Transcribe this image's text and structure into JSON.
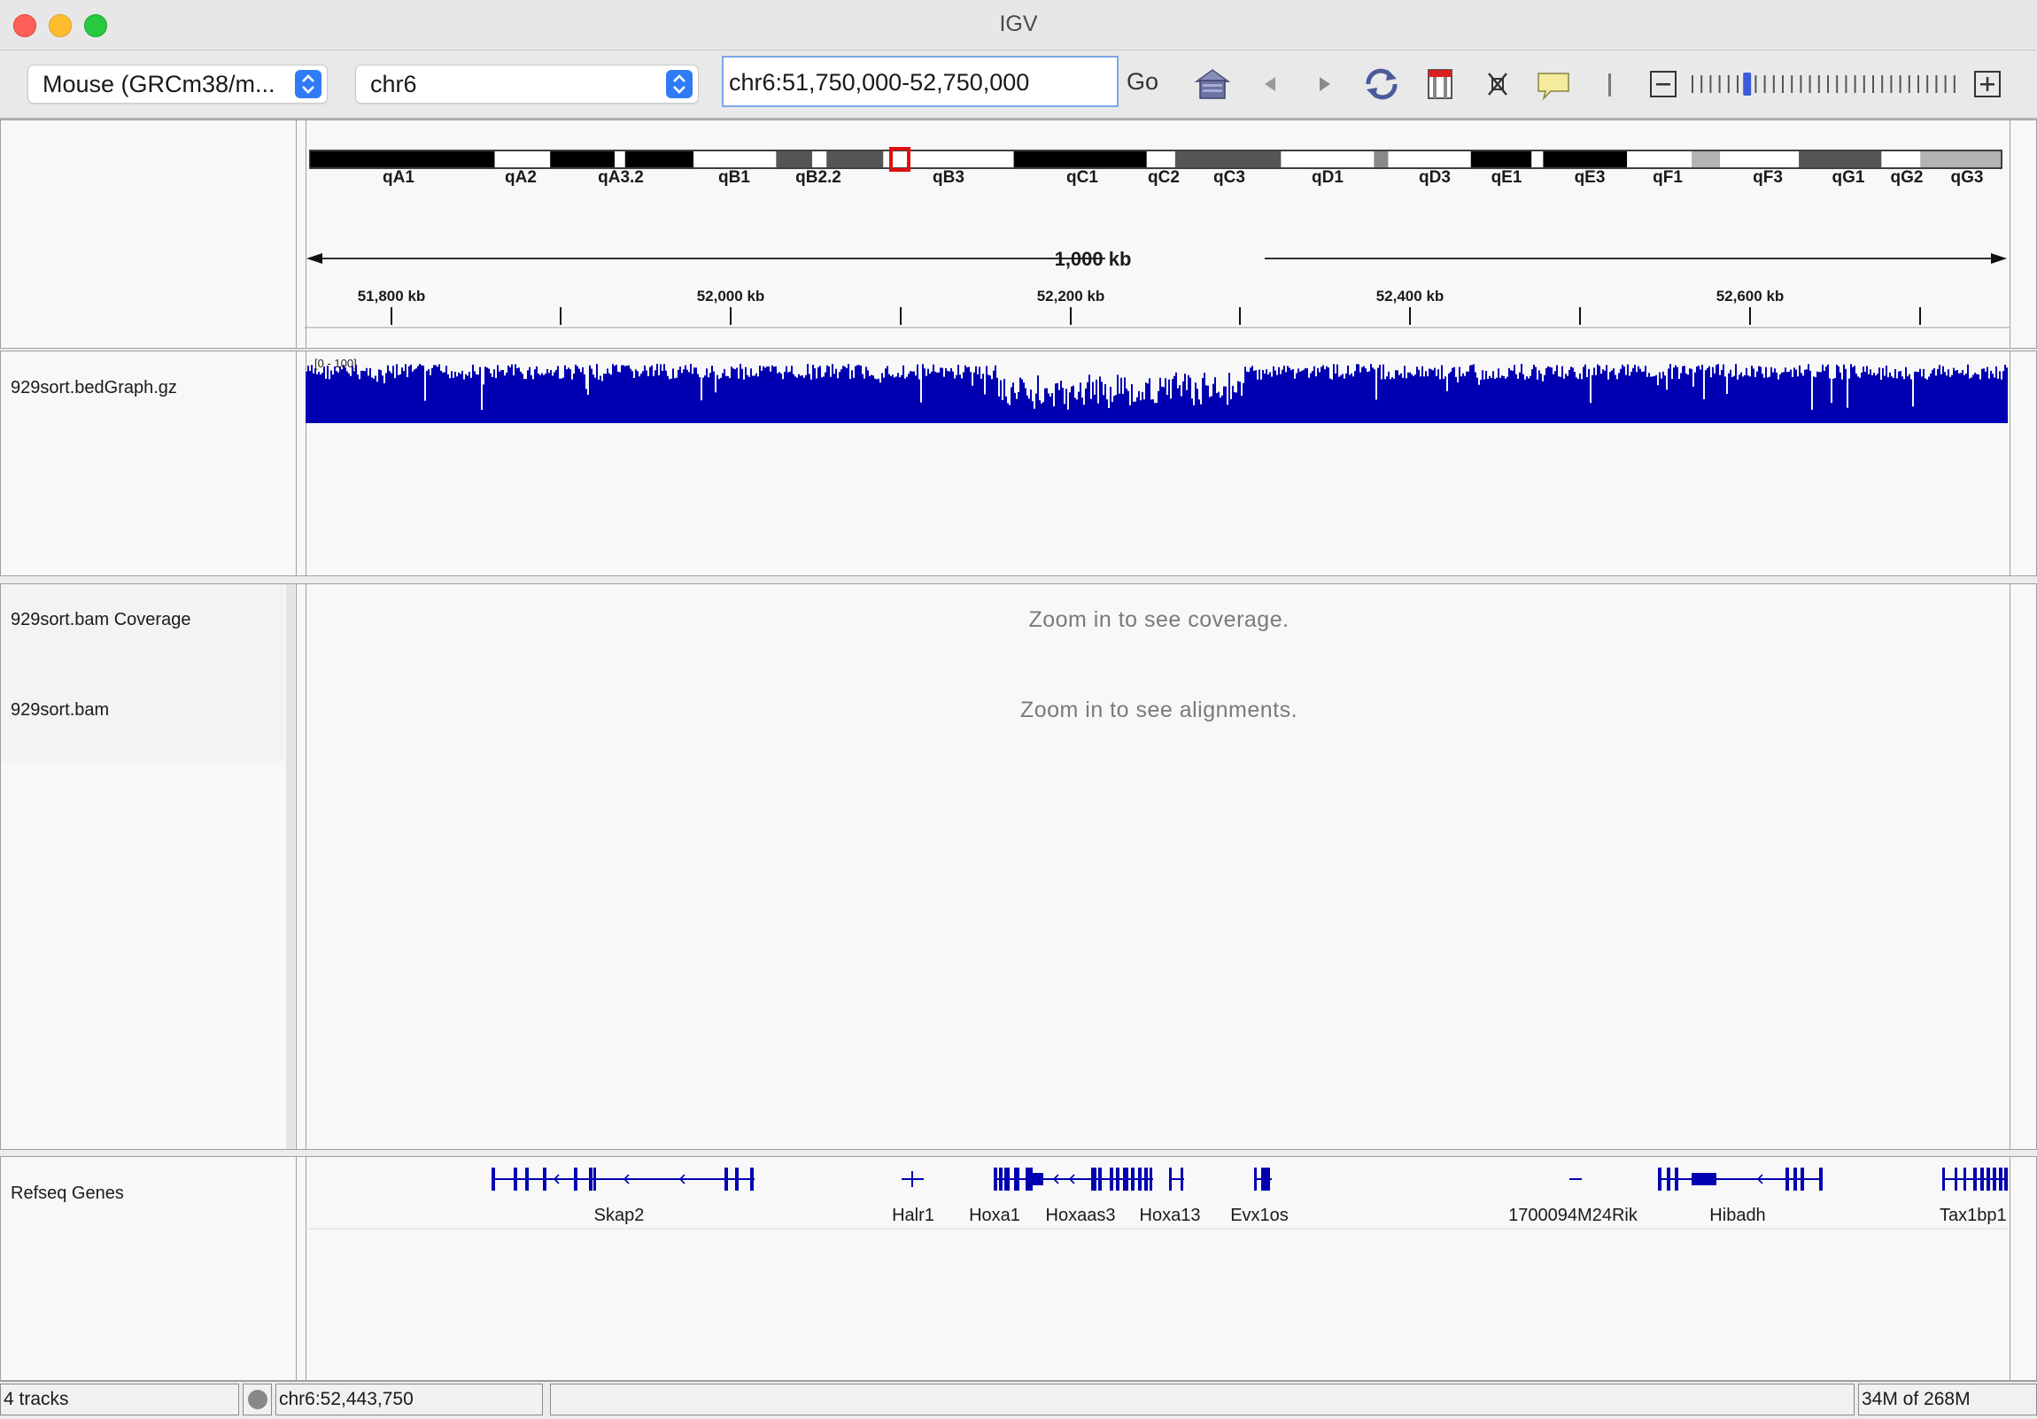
{
  "window": {
    "title": "IGV"
  },
  "toolbar": {
    "genome_select": "Mouse (GRCm38/m...",
    "chromosome_select": "chr6",
    "locus_input": "chr6:51,750,000-52,750,000",
    "go_label": "Go",
    "icons": [
      "home-icon",
      "back-arrow-icon",
      "forward-arrow-icon",
      "refresh-icon",
      "region-of-interest-icon",
      "fit-to-window-icon",
      "popup-info-icon",
      "separator-icon",
      "zoom-out-icon",
      "zoom-slider",
      "zoom-in-icon"
    ],
    "zoom_level_fraction": 0.2
  },
  "ideogram": {
    "bands": [
      "qA1",
      "qA2",
      "qA3.2",
      "qB1",
      "qB2.2",
      "qB3",
      "qC1",
      "qC2",
      "qC3",
      "qD1",
      "qD3",
      "qE1",
      "qE3",
      "qF1",
      "qF3",
      "qG1",
      "qG2",
      "qG3"
    ],
    "colors": {
      "black": "#000000",
      "dark": "#555555",
      "mid": "#888888",
      "light": "#b3b3b3",
      "white": "#ffffff",
      "marker": "#e01010"
    }
  },
  "ruler": {
    "span_label": "1,000 kb",
    "ticks": [
      "51,800 kb",
      "52,000 kb",
      "52,200 kb",
      "52,400 kb",
      "52,600 kb"
    ]
  },
  "tracks": {
    "bedgraph": {
      "name": "929sort.bedGraph.gz",
      "range_label": "[0 - 100]",
      "color": "#0000b2"
    },
    "bam_coverage": {
      "name": "929sort.bam Coverage",
      "message": "Zoom in to see coverage."
    },
    "bam": {
      "name": "929sort.bam",
      "message": "Zoom in to see alignments."
    },
    "refseq": {
      "name": "Refseq Genes",
      "genes": [
        "Skap2",
        "Halr1",
        "Hoxa1",
        "Hoxaas3",
        "Hoxa13",
        "Evx1os",
        "1700094M24Rik",
        "Hibadh",
        "Tax1bp1"
      ]
    }
  },
  "status": {
    "track_count": "4 tracks",
    "position": "chr6:52,443,750",
    "memory": "34M of 268M"
  }
}
